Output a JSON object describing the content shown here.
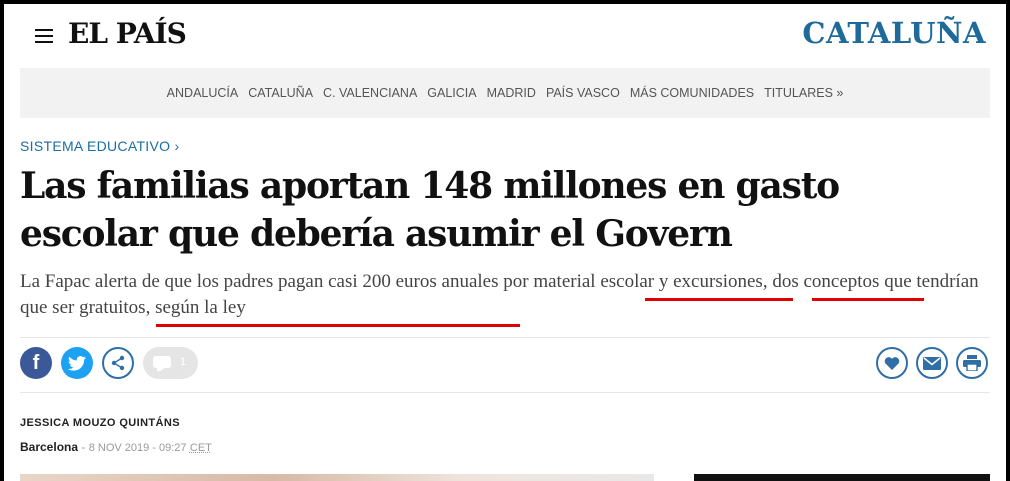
{
  "header": {
    "logo": "EL PAÍS",
    "section": "CATALUÑA",
    "menu_icon": "hamburger-menu-icon"
  },
  "nav": {
    "items": [
      "ANDALUCÍA",
      "CATALUÑA",
      "C. VALENCIANA",
      "GALICIA",
      "MADRID",
      "PAÍS VASCO",
      "MÁS COMUNIDADES",
      "TITULARES »"
    ]
  },
  "article": {
    "kicker": "SISTEMA EDUCATIVO ›",
    "headline": "Las familias aportan 148 millones en gasto escolar que debería asumir el Govern",
    "subhead": {
      "p1": "La Fapac alerta de que los padres pagan casi 200 euros anuales por ",
      "h1": "material escolar",
      "p2": " y ",
      "h2": "excursiones",
      "p3": ", dos conceptos que ",
      "h3": "tendrían que ser gratuitos, según la ley"
    },
    "highlight_color": "#e00000"
  },
  "share": {
    "facebook_icon": "facebook-icon",
    "twitter_icon": "twitter-icon",
    "share_icon": "share-icon",
    "comment_icon": "comment-icon",
    "comment_count": "1",
    "favorite_icon": "heart-icon",
    "mail_icon": "mail-icon",
    "print_icon": "print-icon"
  },
  "byline": {
    "author": "JESSICA MOUZO QUINTÁNS",
    "city": "Barcelona",
    "separator": " - ",
    "date": "8 NOV 2019 - 09:27",
    "timezone": "CET"
  },
  "colors": {
    "brand_blue": "#1e6a9a",
    "facebook": "#3b5998",
    "twitter": "#1da1f2"
  }
}
